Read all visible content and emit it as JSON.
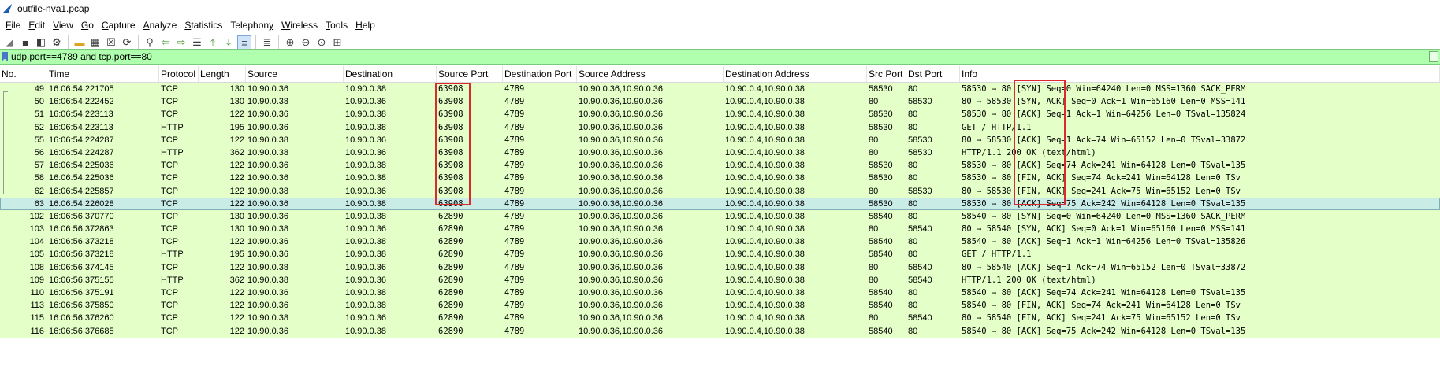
{
  "window": {
    "title": "outfile-nva1.pcap"
  },
  "menu": [
    {
      "pre": "",
      "u": "F",
      "post": "ile"
    },
    {
      "pre": "",
      "u": "E",
      "post": "dit"
    },
    {
      "pre": "",
      "u": "V",
      "post": "iew"
    },
    {
      "pre": "",
      "u": "G",
      "post": "o"
    },
    {
      "pre": "",
      "u": "C",
      "post": "apture"
    },
    {
      "pre": "",
      "u": "A",
      "post": "nalyze"
    },
    {
      "pre": "",
      "u": "S",
      "post": "tatistics"
    },
    {
      "pre": "Telephon",
      "u": "y",
      "post": ""
    },
    {
      "pre": "",
      "u": "W",
      "post": "ireless"
    },
    {
      "pre": "",
      "u": "T",
      "post": "ools"
    },
    {
      "pre": "",
      "u": "H",
      "post": "elp"
    }
  ],
  "filter": {
    "value": "udp.port==4789 and tcp.port==80"
  },
  "columns": [
    "No.",
    "Time",
    "Protocol",
    "Length",
    "Source",
    "Destination",
    "Source Port",
    "Destination Port",
    "Source Address",
    "Destination Address",
    "Src Port",
    "Dst Port",
    "Info"
  ],
  "rows": [
    [
      "49",
      "16:06:54.221705",
      "TCP",
      "130",
      "10.90.0.36",
      "10.90.0.38",
      "63908",
      "4789",
      "10.90.0.36,10.90.0.36",
      "10.90.0.4,10.90.0.38",
      "58530",
      "80",
      "58530 → 80 [SYN] Seq=0 Win=64240 Len=0 MSS=1360 SACK_PERM"
    ],
    [
      "50",
      "16:06:54.222452",
      "TCP",
      "130",
      "10.90.0.38",
      "10.90.0.36",
      "63908",
      "4789",
      "10.90.0.36,10.90.0.36",
      "10.90.0.4,10.90.0.38",
      "80",
      "58530",
      "80 → 58530 [SYN, ACK] Seq=0 Ack=1 Win=65160 Len=0 MSS=141"
    ],
    [
      "51",
      "16:06:54.223113",
      "TCP",
      "122",
      "10.90.0.36",
      "10.90.0.38",
      "63908",
      "4789",
      "10.90.0.36,10.90.0.36",
      "10.90.0.4,10.90.0.38",
      "58530",
      "80",
      "58530 → 80 [ACK] Seq=1 Ack=1 Win=64256 Len=0 TSval=135824"
    ],
    [
      "52",
      "16:06:54.223113",
      "HTTP",
      "195",
      "10.90.0.36",
      "10.90.0.38",
      "63908",
      "4789",
      "10.90.0.36,10.90.0.36",
      "10.90.0.4,10.90.0.38",
      "58530",
      "80",
      "GET / HTTP/1.1"
    ],
    [
      "55",
      "16:06:54.224287",
      "TCP",
      "122",
      "10.90.0.38",
      "10.90.0.36",
      "63908",
      "4789",
      "10.90.0.36,10.90.0.36",
      "10.90.0.4,10.90.0.38",
      "80",
      "58530",
      "80 → 58530 [ACK] Seq=1 Ack=74 Win=65152 Len=0 TSval=33872"
    ],
    [
      "56",
      "16:06:54.224287",
      "HTTP",
      "362",
      "10.90.0.38",
      "10.90.0.36",
      "63908",
      "4789",
      "10.90.0.36,10.90.0.36",
      "10.90.0.4,10.90.0.38",
      "80",
      "58530",
      "HTTP/1.1 200 OK  (text/html)"
    ],
    [
      "57",
      "16:06:54.225036",
      "TCP",
      "122",
      "10.90.0.36",
      "10.90.0.38",
      "63908",
      "4789",
      "10.90.0.36,10.90.0.36",
      "10.90.0.4,10.90.0.38",
      "58530",
      "80",
      "58530 → 80 [ACK] Seq=74 Ack=241 Win=64128 Len=0 TSval=135"
    ],
    [
      "58",
      "16:06:54.225036",
      "TCP",
      "122",
      "10.90.0.36",
      "10.90.0.38",
      "63908",
      "4789",
      "10.90.0.36,10.90.0.36",
      "10.90.0.4,10.90.0.38",
      "58530",
      "80",
      "58530 → 80 [FIN, ACK] Seq=74 Ack=241 Win=64128 Len=0 TSv"
    ],
    [
      "62",
      "16:06:54.225857",
      "TCP",
      "122",
      "10.90.0.38",
      "10.90.0.36",
      "63908",
      "4789",
      "10.90.0.36,10.90.0.36",
      "10.90.0.4,10.90.0.38",
      "80",
      "58530",
      "80 → 58530 [FIN, ACK] Seq=241 Ack=75 Win=65152 Len=0 TSv"
    ],
    [
      "63",
      "16:06:54.226028",
      "TCP",
      "122",
      "10.90.0.36",
      "10.90.0.38",
      "63908",
      "4789",
      "10.90.0.36,10.90.0.36",
      "10.90.0.4,10.90.0.38",
      "58530",
      "80",
      "58530 → 80 [ACK] Seq=75 Ack=242 Win=64128 Len=0 TSval=135"
    ],
    [
      "102",
      "16:06:56.370770",
      "TCP",
      "130",
      "10.90.0.36",
      "10.90.0.38",
      "62890",
      "4789",
      "10.90.0.36,10.90.0.36",
      "10.90.0.4,10.90.0.38",
      "58540",
      "80",
      "58540 → 80 [SYN] Seq=0 Win=64240 Len=0 MSS=1360 SACK_PERM"
    ],
    [
      "103",
      "16:06:56.372863",
      "TCP",
      "130",
      "10.90.0.38",
      "10.90.0.36",
      "62890",
      "4789",
      "10.90.0.36,10.90.0.36",
      "10.90.0.4,10.90.0.38",
      "80",
      "58540",
      "80 → 58540 [SYN, ACK] Seq=0 Ack=1 Win=65160 Len=0 MSS=141"
    ],
    [
      "104",
      "16:06:56.373218",
      "TCP",
      "122",
      "10.90.0.36",
      "10.90.0.38",
      "62890",
      "4789",
      "10.90.0.36,10.90.0.36",
      "10.90.0.4,10.90.0.38",
      "58540",
      "80",
      "58540 → 80 [ACK] Seq=1 Ack=1 Win=64256 Len=0 TSval=135826"
    ],
    [
      "105",
      "16:06:56.373218",
      "HTTP",
      "195",
      "10.90.0.36",
      "10.90.0.38",
      "62890",
      "4789",
      "10.90.0.36,10.90.0.36",
      "10.90.0.4,10.90.0.38",
      "58540",
      "80",
      "GET / HTTP/1.1"
    ],
    [
      "108",
      "16:06:56.374145",
      "TCP",
      "122",
      "10.90.0.38",
      "10.90.0.36",
      "62890",
      "4789",
      "10.90.0.36,10.90.0.36",
      "10.90.0.4,10.90.0.38",
      "80",
      "58540",
      "80 → 58540 [ACK] Seq=1 Ack=74 Win=65152 Len=0 TSval=33872"
    ],
    [
      "109",
      "16:06:56.375155",
      "HTTP",
      "362",
      "10.90.0.38",
      "10.90.0.36",
      "62890",
      "4789",
      "10.90.0.36,10.90.0.36",
      "10.90.0.4,10.90.0.38",
      "80",
      "58540",
      "HTTP/1.1 200 OK  (text/html)"
    ],
    [
      "110",
      "16:06:56.375191",
      "TCP",
      "122",
      "10.90.0.36",
      "10.90.0.38",
      "62890",
      "4789",
      "10.90.0.36,10.90.0.36",
      "10.90.0.4,10.90.0.38",
      "58540",
      "80",
      "58540 → 80 [ACK] Seq=74 Ack=241 Win=64128 Len=0 TSval=135"
    ],
    [
      "113",
      "16:06:56.375850",
      "TCP",
      "122",
      "10.90.0.36",
      "10.90.0.38",
      "62890",
      "4789",
      "10.90.0.36,10.90.0.36",
      "10.90.0.4,10.90.0.38",
      "58540",
      "80",
      "58540 → 80 [FIN, ACK] Seq=74 Ack=241 Win=64128 Len=0 TSv"
    ],
    [
      "115",
      "16:06:56.376260",
      "TCP",
      "122",
      "10.90.0.38",
      "10.90.0.36",
      "62890",
      "4789",
      "10.90.0.36,10.90.0.36",
      "10.90.0.4,10.90.0.38",
      "80",
      "58540",
      "80 → 58540 [FIN, ACK] Seq=241 Ack=75 Win=65152 Len=0 TSv"
    ],
    [
      "116",
      "16:06:56.376685",
      "TCP",
      "122",
      "10.90.0.36",
      "10.90.0.38",
      "62890",
      "4789",
      "10.90.0.36,10.90.0.36",
      "10.90.0.4,10.90.0.38",
      "58540",
      "80",
      "58540 → 80 [ACK] Seq=75 Ack=242 Win=64128 Len=0 TSval=135"
    ]
  ],
  "selected_row": 9,
  "colors": {
    "row_bg": "#e4ffc7",
    "selected_bg": "#c9ece7",
    "filter_bg": "#afffaf",
    "highlight": "#d92b2b"
  },
  "toolbar_icons": [
    "shark-fin-start-icon",
    "stop-icon",
    "restart-icon",
    "options-icon",
    "sep",
    "open-folder-icon",
    "save-icon",
    "close-file-icon",
    "reload-icon",
    "sep",
    "find-icon",
    "back-icon",
    "forward-icon",
    "goto-icon",
    "first-icon",
    "last-icon",
    "autoscroll-icon",
    "sep",
    "colorize-icon",
    "sep",
    "zoom-in-icon",
    "zoom-out-icon",
    "zoom-reset-icon",
    "resize-columns-icon"
  ]
}
